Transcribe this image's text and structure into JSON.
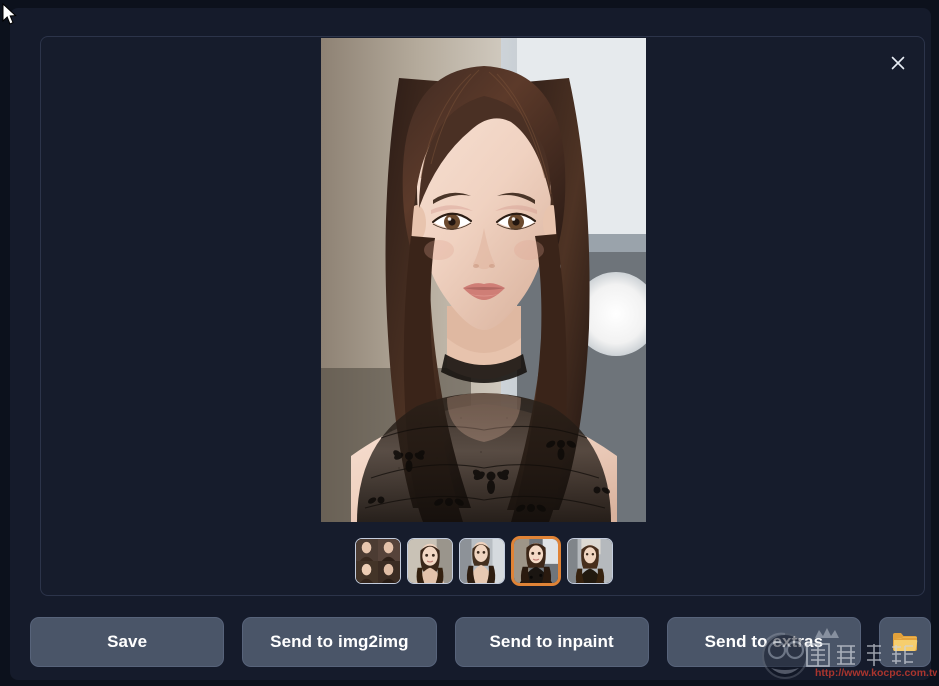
{
  "window": {
    "background_color": "#0c111c",
    "panel_color": "#151b2b",
    "gallery_color": "#161c2c",
    "accent_color": "#e08336",
    "button_color": "#4a5568"
  },
  "gallery": {
    "close_label": "×",
    "selected_index": 3,
    "image_count": 5,
    "thumbnails": [
      {
        "name": "thumbnail-1",
        "kind": "grid-collage",
        "selected": false
      },
      {
        "name": "thumbnail-2",
        "kind": "portrait",
        "selected": false
      },
      {
        "name": "thumbnail-3",
        "kind": "portrait",
        "selected": false
      },
      {
        "name": "thumbnail-4",
        "kind": "portrait",
        "selected": true
      },
      {
        "name": "thumbnail-5",
        "kind": "portrait",
        "selected": false
      }
    ],
    "preview": {
      "name": "generated-portrait",
      "description": "AI generated portrait of a woman with long brown hair wearing a black floral lace top"
    }
  },
  "actions": {
    "save": "Save",
    "send_to_img2img": "Send to img2img",
    "send_to_inpaint": "Send to inpaint",
    "send_to_extras": "Send to extras",
    "open_folder": "folder-icon"
  },
  "watermark": {
    "title": "電腦王阿達",
    "url": "http://www.kocpc.com.tw"
  }
}
